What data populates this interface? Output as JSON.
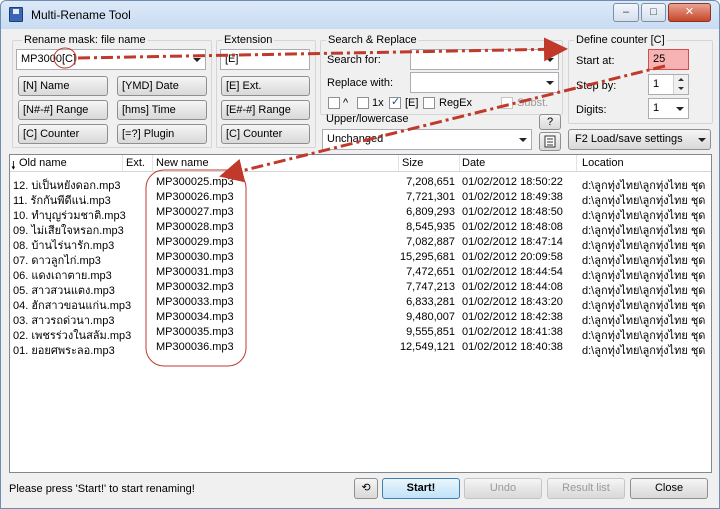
{
  "window": {
    "title": "Multi-Rename Tool",
    "minimize": "–",
    "maximize": "□",
    "close": "✕"
  },
  "rename_mask": {
    "group_label": "Rename mask: file name",
    "value": "MP3000[C]",
    "buttons": [
      "[N] Name",
      "[YMD] Date",
      "[N#-#] Range",
      "[hms] Time",
      "[C] Counter",
      "[=?] Plugin"
    ]
  },
  "extension": {
    "group_label": "Extension",
    "value": "[E]",
    "buttons": [
      "[E] Ext.",
      "[E#-#] Range",
      "[C] Counter"
    ]
  },
  "search_replace": {
    "group_label": "Search & Replace",
    "search_label": "Search for:",
    "replace_label": "Replace with:",
    "search_value": "",
    "replace_value": "",
    "options": [
      {
        "label": "^",
        "checked": false
      },
      {
        "label": "1x",
        "checked": false
      },
      {
        "label": "[E]",
        "checked": true
      },
      {
        "label": "RegEx",
        "checked": false
      },
      {
        "label": "Subst.",
        "checked": false
      }
    ]
  },
  "case": {
    "group_label": "Upper/lowercase",
    "value": "Unchanged",
    "help_label": "?"
  },
  "counter": {
    "group_label": "Define counter [C]",
    "start_label": "Start at:",
    "start_value": "25",
    "step_label": "Step by:",
    "step_value": "1",
    "digits_label": "Digits:",
    "digits_value": "1",
    "settings_label": "F2 Load/save settings"
  },
  "table": {
    "columns": [
      "Old name",
      "Ext.",
      "New name",
      "Size",
      "Date",
      "Location"
    ],
    "rows": [
      {
        "old": "12. บ่เป็นหยังดอก.mp3",
        "ext": "",
        "new": "MP300025.mp3",
        "size": "7,208,651",
        "date": "01/02/2012 18:50:22",
        "location": "d:\\ลูกทุ่งไทย\\ลูกทุ่งไทย ชุด"
      },
      {
        "old": "11. รักกันพีดีแน่.mp3",
        "ext": "",
        "new": "MP300026.mp3",
        "size": "7,721,301",
        "date": "01/02/2012 18:49:38",
        "location": "d:\\ลูกทุ่งไทย\\ลูกทุ่งไทย ชุด"
      },
      {
        "old": "10. ทำบุญร่วมชาติ.mp3",
        "ext": "",
        "new": "MP300027.mp3",
        "size": "6,809,293",
        "date": "01/02/2012 18:48:50",
        "location": "d:\\ลูกทุ่งไทย\\ลูกทุ่งไทย ชุด"
      },
      {
        "old": "09. ไม่เสียใจหรอก.mp3",
        "ext": "",
        "new": "MP300028.mp3",
        "size": "8,545,935",
        "date": "01/02/2012 18:48:08",
        "location": "d:\\ลูกทุ่งไทย\\ลูกทุ่งไทย ชุด"
      },
      {
        "old": "08. บ้านไร่นารัก.mp3",
        "ext": "",
        "new": "MP300029.mp3",
        "size": "7,082,887",
        "date": "01/02/2012 18:47:14",
        "location": "d:\\ลูกทุ่งไทย\\ลูกทุ่งไทย ชุด"
      },
      {
        "old": "07. ดาวลูกไก่.mp3",
        "ext": "",
        "new": "MP300030.mp3",
        "size": "15,295,681",
        "date": "01/02/2012 20:09:58",
        "location": "d:\\ลูกทุ่งไทย\\ลูกทุ่งไทย ชุด"
      },
      {
        "old": "06. แดงเถาตาย.mp3",
        "ext": "",
        "new": "MP300031.mp3",
        "size": "7,472,651",
        "date": "01/02/2012 18:44:54",
        "location": "d:\\ลูกทุ่งไทย\\ลูกทุ่งไทย ชุด"
      },
      {
        "old": "05. สาวสวนแตง.mp3",
        "ext": "",
        "new": "MP300032.mp3",
        "size": "7,747,213",
        "date": "01/02/2012 18:44:08",
        "location": "d:\\ลูกทุ่งไทย\\ลูกทุ่งไทย ชุด"
      },
      {
        "old": "04. ฮักสาวขอนแก่น.mp3",
        "ext": "",
        "new": "MP300033.mp3",
        "size": "6,833,281",
        "date": "01/02/2012 18:43:20",
        "location": "d:\\ลูกทุ่งไทย\\ลูกทุ่งไทย ชุด"
      },
      {
        "old": "03. สาวรถด่วนา.mp3",
        "ext": "",
        "new": "MP300034.mp3",
        "size": "9,480,007",
        "date": "01/02/2012 18:42:38",
        "location": "d:\\ลูกทุ่งไทย\\ลูกทุ่งไทย ชุด"
      },
      {
        "old": "02. เพชรร่วงในสลัม.mp3",
        "ext": "",
        "new": "MP300035.mp3",
        "size": "9,555,851",
        "date": "01/02/2012 18:41:38",
        "location": "d:\\ลูกทุ่งไทย\\ลูกทุ่งไทย ชุด"
      },
      {
        "old": "01. ยอยศพระลอ.mp3",
        "ext": "",
        "new": "MP300036.mp3",
        "size": "12,549,121",
        "date": "01/02/2012 18:40:38",
        "location": "d:\\ลูกทุ่งไทย\\ลูกทุ่งไทย ชุด"
      }
    ]
  },
  "footer": {
    "status": "Please press 'Start!' to start renaming!",
    "start": "Start!",
    "undo": "Undo",
    "result_list": "Result list",
    "close": "Close"
  },
  "colors": {
    "annotation": "#c0392b",
    "highlight_field": "#f7b3b3",
    "title_bar": "#dce9f8"
  }
}
